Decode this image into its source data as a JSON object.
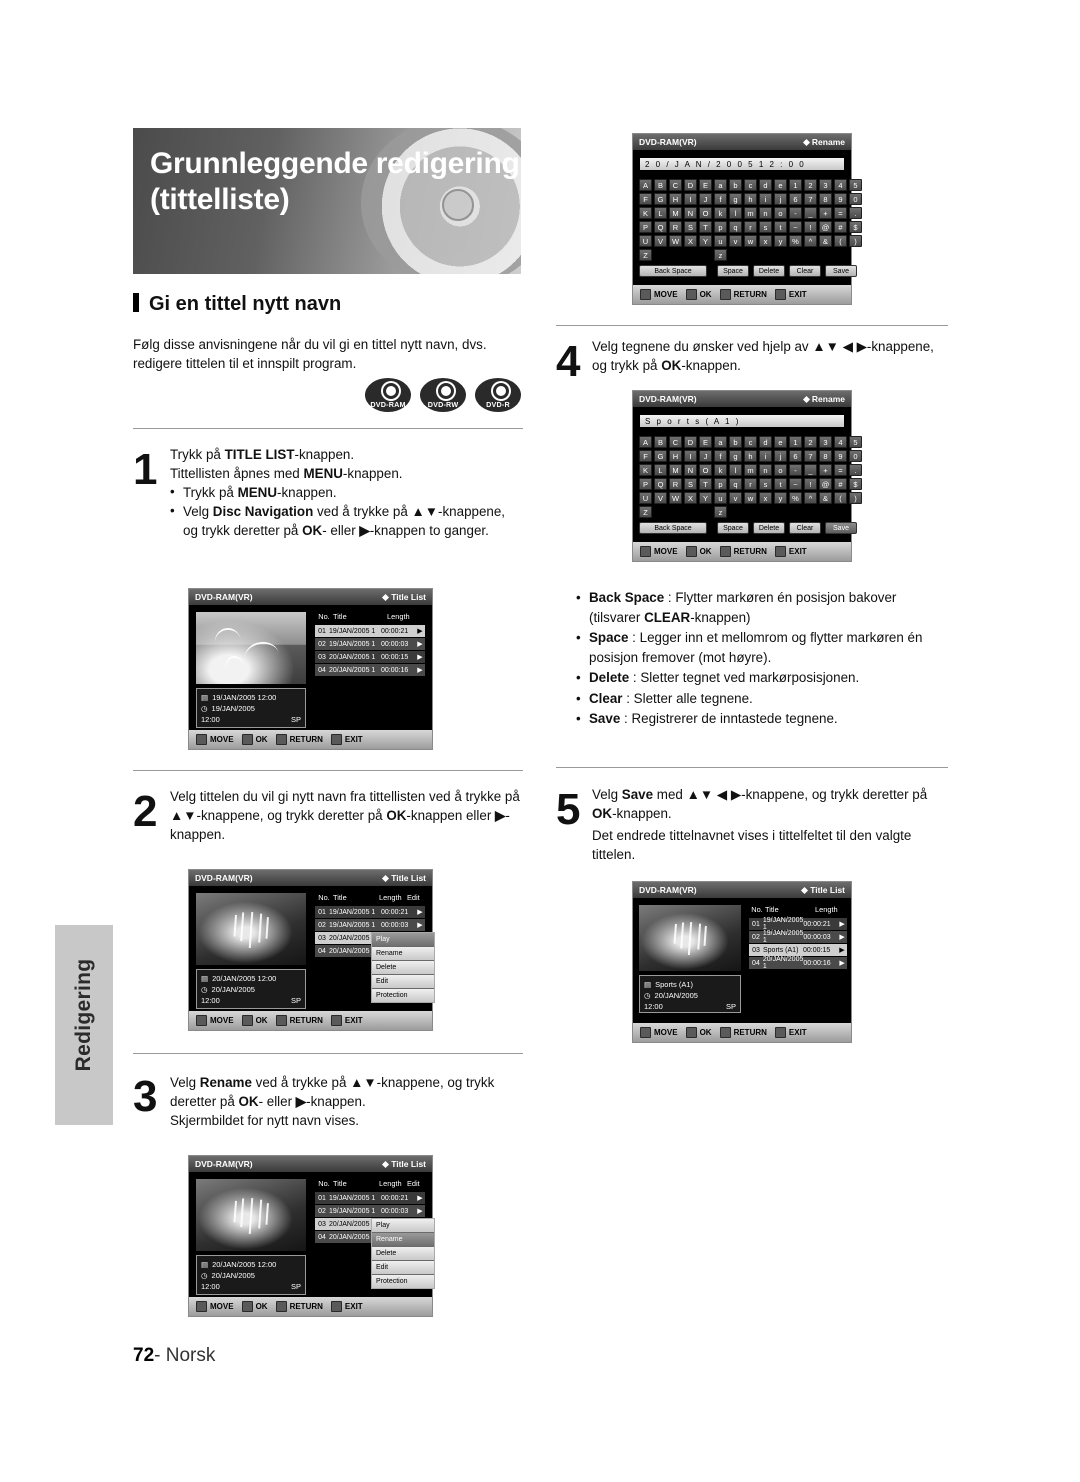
{
  "sidebar": {
    "tab_label": "Redigering"
  },
  "header": {
    "title_line1": "Grunnleggende redigering",
    "title_line2": "(tittelliste)"
  },
  "section": {
    "heading": "Gi en tittel nytt navn",
    "intro": "Følg disse anvisningene når du vil gi en tittel nytt navn, dvs. redigere tittelen til et innspilt program."
  },
  "disc_logos": [
    {
      "name": "DVD-RAM"
    },
    {
      "name": "DVD-RW"
    },
    {
      "name": "DVD-R"
    }
  ],
  "steps": {
    "s1": {
      "num": "1",
      "line1_a": "Trykk på ",
      "line1_b": "TITLE LIST",
      "line1_c": "-knappen.",
      "line2_a": "Tittellisten åpnes med ",
      "line2_b": "MENU",
      "line2_c": "-knappen.",
      "b1_a": "Trykk på ",
      "b1_b": "MENU",
      "b1_c": "-knappen.",
      "b2_a": "Velg ",
      "b2_b": "Disc Navigation",
      "b2_c": " ved å trykke på ▲▼-knappene, og trykk deretter på ",
      "b2_d": "OK",
      "b2_e": "- eller ",
      "b2_f": "-knappen to ganger."
    },
    "s2": {
      "num": "2",
      "t_a": "Velg tittelen du vil gi nytt navn fra tittellisten ved å trykke på ▲▼-knappene, og trykk deretter på ",
      "t_b": "OK",
      "t_c": "-knappen eller ",
      "t_d": "-knappen."
    },
    "s3": {
      "num": "3",
      "t_a": "Velg ",
      "t_b": "Rename",
      "t_c": " ved å trykke på ▲▼-knappene, og trykk deretter på ",
      "t_d": "OK",
      "t_e": "- eller ",
      "t_f": "-knappen.",
      "t_g": "Skjermbildet for nytt navn vises."
    },
    "s4": {
      "num": "4",
      "t_a": "Velg tegnene du ønsker ved hjelp av ▲▼ ◀ ▶-knappene, og trykk på ",
      "t_b": "OK",
      "t_c": "-knappen."
    },
    "s5": {
      "num": "5",
      "t_a": "Velg ",
      "t_b": "Save",
      "t_c": " med ▲▼ ◀ ▶-knappene, og trykk deretter på ",
      "t_d": "OK",
      "t_e": "-knappen.",
      "t_f": "Det endrede tittelnavnet vises i tittelfeltet til den valgte tittelen."
    }
  },
  "key_help": [
    {
      "label": "Back Space",
      "sep": " : ",
      "desc": "Flytter markøren én posisjon bakover (tilsvarer ",
      "bold2": "CLEAR",
      "desc2": "-knappen)"
    },
    {
      "label": "Space",
      "sep": " : ",
      "desc": "Legger inn et mellomrom og flytter markøren én posisjon fremover (mot høyre)."
    },
    {
      "label": "Delete",
      "sep": " : ",
      "desc": "Sletter tegnet ved markørposisjonen."
    },
    {
      "label": "Clear",
      "sep": " : ",
      "desc": "Sletter alle tegnene."
    },
    {
      "label": "Save",
      "sep": " : ",
      "desc": "Registrerer de inntastede tegnene."
    }
  ],
  "osd": {
    "disc_label": "DVD-RAM(VR)",
    "title_list_label": "Title List",
    "rename_label": "Rename",
    "footer": {
      "move": "MOVE",
      "ok": "OK",
      "return": "RETURN",
      "exit": "EXIT"
    },
    "columns": {
      "no": "No.",
      "title": "Title",
      "length": "Length",
      "edit": "Edit"
    },
    "rows": [
      {
        "no": "01",
        "title": "19/JAN/2005 1",
        "len": "00:00:21"
      },
      {
        "no": "02",
        "title": "19/JAN/2005 1",
        "len": "00:00:03"
      },
      {
        "no": "03",
        "title": "20/JAN/2005 1",
        "len": "00:00:15"
      },
      {
        "no": "04",
        "title": "20/JAN/2005 1",
        "len": "00:00:16"
      }
    ],
    "rows_renamed": [
      {
        "no": "01",
        "title": "19/JAN/2005 1",
        "len": "00:00:21"
      },
      {
        "no": "02",
        "title": "19/JAN/2005 1",
        "len": "00:00:03"
      },
      {
        "no": "03",
        "title": "Sports (A1)",
        "len": "00:00:15"
      },
      {
        "no": "04",
        "title": "20/JAN/2005 1",
        "len": "00:00:16"
      }
    ],
    "info1": {
      "date": "19/JAN/2005 12:00",
      "date2": "19/JAN/2005",
      "time": "12:00",
      "mode": "SP"
    },
    "info2": {
      "date": "20/JAN/2005 12:00",
      "date2": "20/JAN/2005",
      "time": "12:00",
      "mode": "SP"
    },
    "info3": {
      "date": "Sports (A1)",
      "date2": "20/JAN/2005",
      "time": "12:00",
      "mode": "SP"
    },
    "context_menu": [
      "Play",
      "Rename",
      "Delete",
      "Edit",
      "Protection"
    ],
    "rename_screen": {
      "date_field": "2 0 / J A N / 2 0 0 5   1 2 : 0 0",
      "name_field": "S p o r t s ( A 1 )",
      "rows": [
        [
          "A",
          "B",
          "C",
          "D",
          "E"
        ],
        [
          "F",
          "G",
          "H",
          "I",
          "J"
        ],
        [
          "K",
          "L",
          "M",
          "N",
          "O"
        ],
        [
          "P",
          "Q",
          "R",
          "S",
          "T"
        ],
        [
          "U",
          "V",
          "W",
          "X",
          "Y"
        ],
        [
          "Z"
        ]
      ],
      "rows_lower": [
        [
          "a",
          "b",
          "c",
          "d",
          "e"
        ],
        [
          "f",
          "g",
          "h",
          "i",
          "j"
        ],
        [
          "k",
          "l",
          "m",
          "n",
          "o"
        ],
        [
          "p",
          "q",
          "r",
          "s",
          "t"
        ],
        [
          "u",
          "v",
          "w",
          "x",
          "y"
        ],
        [
          "z"
        ]
      ],
      "rows_sym": [
        [
          "1",
          "2",
          "3",
          "4",
          "5"
        ],
        [
          "6",
          "7",
          "8",
          "9",
          "0"
        ],
        [
          "-",
          "_",
          "+",
          "=",
          "."
        ],
        [
          "~",
          "!",
          "@",
          "#",
          "$"
        ],
        [
          "%",
          "^",
          "&",
          "(",
          ")"
        ],
        [
          ""
        ]
      ],
      "buttons": [
        "Back Space",
        "Space",
        "Delete",
        "Clear",
        "Save"
      ]
    }
  },
  "page": {
    "number": "72",
    "dash": "-",
    "lang": "Norsk"
  }
}
